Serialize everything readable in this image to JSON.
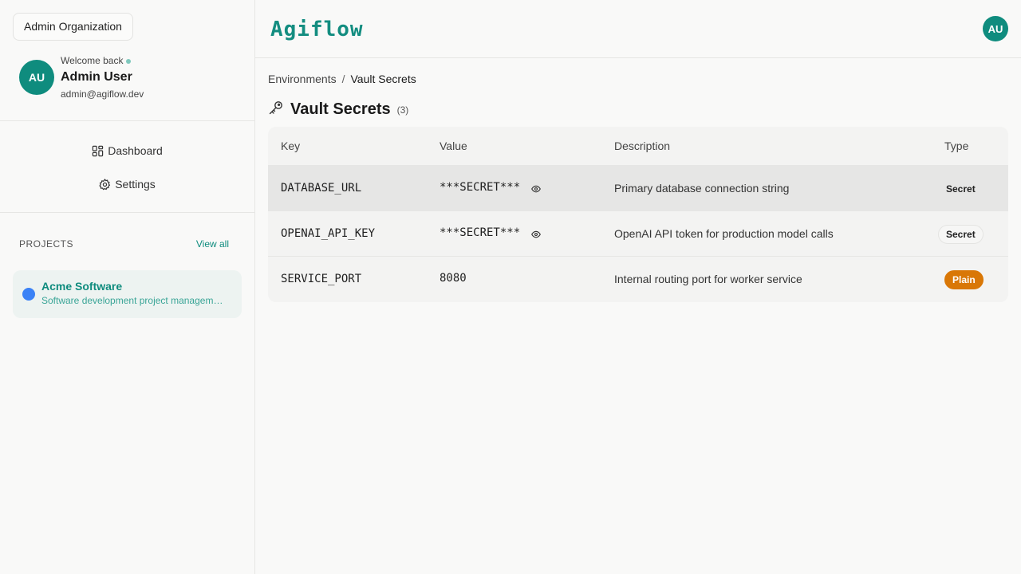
{
  "sidebar": {
    "org_label": "Admin Organization",
    "user": {
      "avatar_initials": "AU",
      "welcome": "Welcome back",
      "name": "Admin User",
      "email": "admin@agiflow.dev"
    },
    "nav": [
      {
        "label": "Dashboard",
        "icon": "dashboard-icon"
      },
      {
        "label": "Settings",
        "icon": "gear-icon"
      }
    ],
    "projects": {
      "title": "PROJECTS",
      "view_all": "View all",
      "items": [
        {
          "name": "Acme Software",
          "description": "Software development project management",
          "color": "#3b82f6"
        }
      ]
    }
  },
  "header": {
    "logo": "Agiflow",
    "avatar_initials": "AU"
  },
  "breadcrumb": {
    "parent": "Environments",
    "separator": "/",
    "current": "Vault Secrets"
  },
  "page": {
    "title": "Vault Secrets",
    "count": "(3)",
    "icon": "key-icon"
  },
  "table": {
    "columns": [
      "Key",
      "Value",
      "Description",
      "Type"
    ],
    "rows": [
      {
        "key": "DATABASE_URL",
        "value": "***SECRET***",
        "masked": true,
        "description": "Primary database connection string",
        "type": "Secret"
      },
      {
        "key": "OPENAI_API_KEY",
        "value": "***SECRET***",
        "masked": true,
        "description": "OpenAI API token for production model calls",
        "type": "Secret"
      },
      {
        "key": "SERVICE_PORT",
        "value": "8080",
        "masked": false,
        "description": "Internal routing port for worker service",
        "type": "Plain"
      }
    ]
  },
  "colors": {
    "brand": "#138d80",
    "accent": "#0f8c7e",
    "plain_badge": "#d97706",
    "project_dot": "#3b82f6"
  }
}
